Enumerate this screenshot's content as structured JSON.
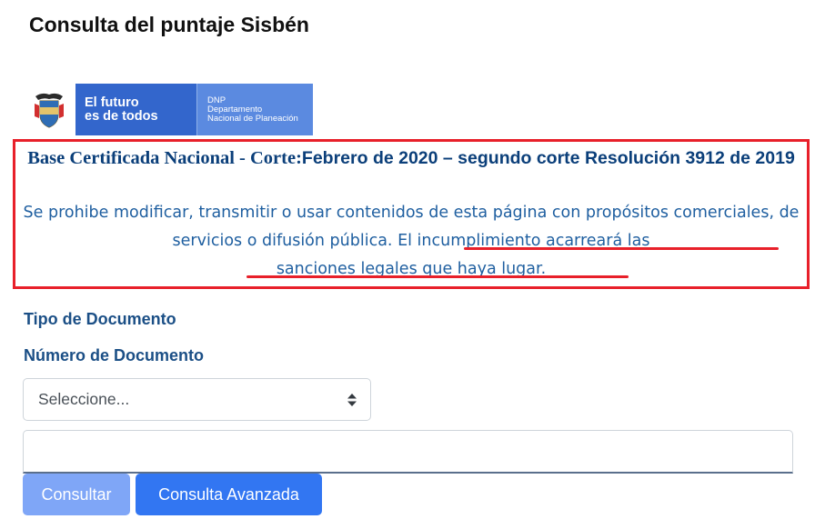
{
  "page": {
    "title": "Consulta del puntaje Sisbén"
  },
  "logo": {
    "slogan_line1": "El futuro",
    "slogan_line2": "es de todos",
    "org_acronym": "DNP",
    "org_line1": "Departamento",
    "org_line2": "Nacional de Planeación"
  },
  "notice": {
    "heading_serif": "Base Certificada Nacional - Corte:",
    "heading_sans": "Febrero de 2020 – segundo corte Resolución 3912 de 2019",
    "body_plain": "Se prohibe modificar, transmitir o usar contenidos de esta página con propósitos comerciales, de servicios o difusión pública. ",
    "body_underlined_1": "El incumplimiento acarreará las",
    "body_underlined_2": "sanciones legales que haya lugar."
  },
  "form": {
    "tipo_label": "Tipo de Documento",
    "numero_label": "Número de Documento",
    "select_value": "Seleccione...",
    "numero_value": ""
  },
  "buttons": {
    "consultar": "Consultar",
    "avanzada": "Consulta Avanzada"
  },
  "colors": {
    "accent": "#3276f2",
    "disabled_button": "#7fa6f7",
    "highlight_border": "#e8202a",
    "label_blue": "#1b4f86"
  }
}
